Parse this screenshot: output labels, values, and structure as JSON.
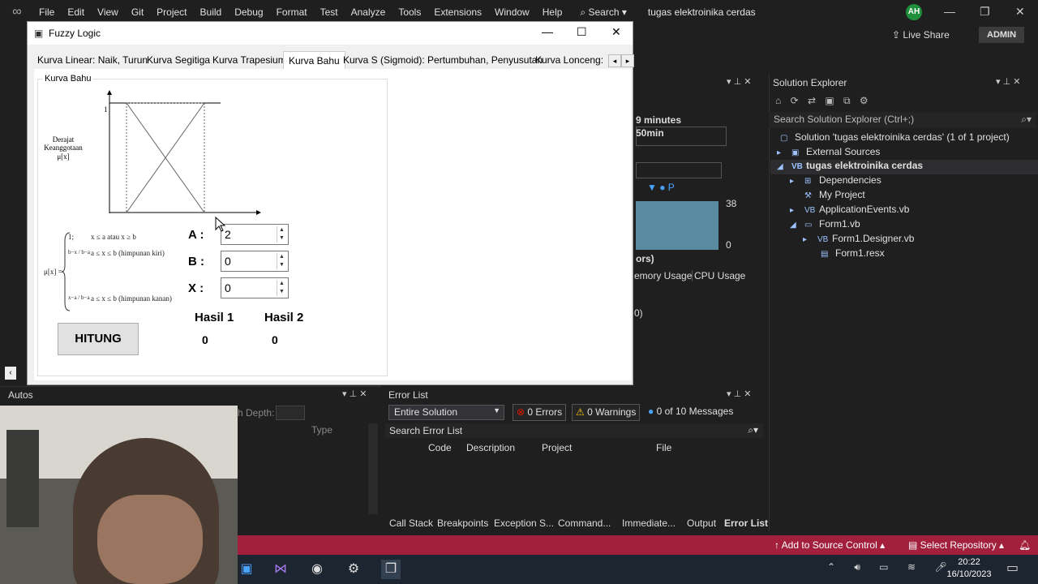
{
  "vs": {
    "menu": [
      "File",
      "Edit",
      "View",
      "Git",
      "Project",
      "Build",
      "Debug",
      "Format",
      "Test",
      "Analyze",
      "Tools",
      "Extensions",
      "Window",
      "Help"
    ],
    "search_label": "Search",
    "title": "tugas elektroinika cerdas",
    "avatar": "AH",
    "live_share": "Live Share",
    "admin": "ADMIN"
  },
  "fuzzy": {
    "title": "Fuzzy Logic",
    "tabs": [
      "Kurva Linear: Naik, Turun",
      "Kurva Segitiga",
      "Kurva Trapesium",
      "Kurva Bahu",
      "Kurva S (Sigmoid): Pertumbuhan, Penyusutan",
      "Kurva Lonceng: Pi"
    ],
    "active_tab": "Kurva Bahu",
    "group_title": "Kurva Bahu",
    "chart": {
      "ylabel_line1": "Derajat",
      "ylabel_line2": "Keanggotaan",
      "ylabel_line3": "μ[x]",
      "y_one": "1"
    },
    "formula": {
      "lhs": "μ[x] =",
      "case1_val": "1;",
      "case1_cond": "x ≤ a atau x ≥ b",
      "case2_val": "b−x / b−a",
      "case2_cond": "a ≤ x ≤ b (himpunan kiri)",
      "case3_val": "x−a / b−a",
      "case3_cond": "a ≤ x ≤ b (himpunan kanan)"
    },
    "fields": [
      {
        "label": "A :",
        "value": "2"
      },
      {
        "label": "B :",
        "value": "0"
      },
      {
        "label": "X :",
        "value": "0"
      }
    ],
    "hitung": "HITUNG",
    "hasil1_label": "Hasil 1",
    "hasil2_label": "Hasil 2",
    "hasil1": "0",
    "hasil2": "0"
  },
  "diag": {
    "minutes": "9 minutes",
    "min50": "50min",
    "val38": "38",
    "val0": "0",
    "ors": "ors)",
    "memory": "emory Usage",
    "cpu": "CPU Usage",
    "paren": "0)"
  },
  "solution_explorer": {
    "title": "Solution Explorer",
    "search": "Search Solution Explorer (Ctrl+;)",
    "items": [
      "Solution 'tugas elektroinika cerdas' (1 of 1 project)",
      "External Sources",
      "tugas elektroinika cerdas",
      "Dependencies",
      "My Project",
      "ApplicationEvents.vb",
      "Form1.vb",
      "Form1.Designer.vb",
      "Form1.resx"
    ]
  },
  "autos": {
    "title": "Autos",
    "depth": "h Depth:",
    "type_col": "Type"
  },
  "error_list": {
    "title": "Error List",
    "scope": "Entire Solution",
    "errors": "0 Errors",
    "warnings": "0 Warnings",
    "messages": "0 of 10 Messages",
    "search": "Search Error List",
    "columns": [
      "Code",
      "Description",
      "Project",
      "File"
    ]
  },
  "bottom_tabs": [
    "Call Stack",
    "Breakpoints",
    "Exception S...",
    "Command...",
    "Immediate...",
    "Output",
    "Error List"
  ],
  "status": {
    "source_control": "Add to Source Control",
    "repo": "Select Repository"
  },
  "clock": {
    "time": "20:22",
    "date": "16/10/2023"
  }
}
